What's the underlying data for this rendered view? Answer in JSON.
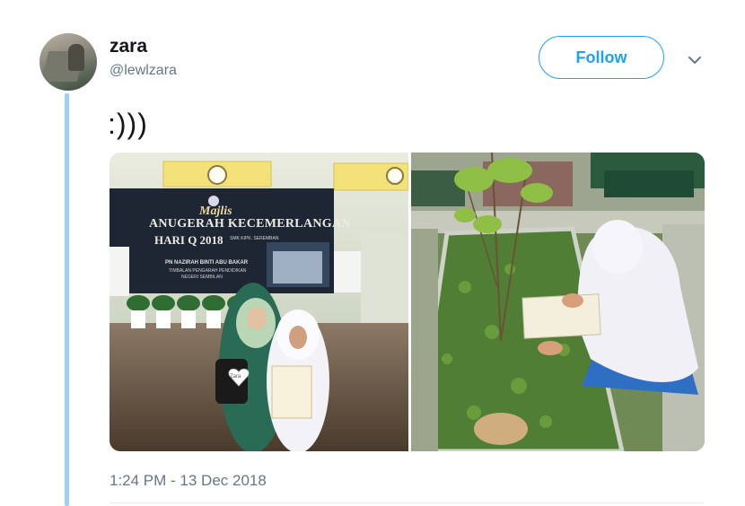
{
  "tweet": {
    "author_name": "zara",
    "author_handle": "@lewlzara",
    "follow_label": "Follow",
    "text": ":)))",
    "timestamp": "1:24 PM - 13 Dec 2018"
  },
  "photo_left": {
    "banner_script": "Majlis",
    "banner_line1": "ANUGERAH KECEMERLANGAN",
    "banner_line2": "HARI Q 2018",
    "banner_small": "SMK KIPK. SEREMBAN",
    "banner_sub1": "PN NAZIRAH BINTI ABU BAKAR",
    "banner_sub2": "TIMBALAN PENGARAH PENDIDIKAN",
    "banner_sub3": "NEGERI SEMBILAN",
    "heart_text": "Zara"
  },
  "colors": {
    "accent": "#1da1f2",
    "thread_line": "#9ed0f3",
    "text_primary": "#14171a",
    "text_secondary": "#657786"
  },
  "icons": [
    "chevron-down-icon"
  ]
}
